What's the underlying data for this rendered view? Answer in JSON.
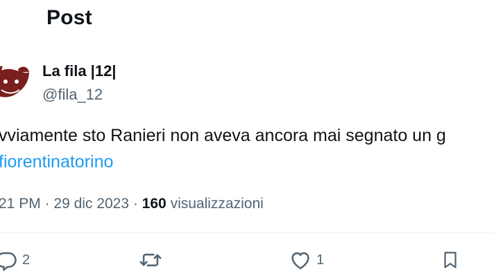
{
  "header": {
    "title": "Post"
  },
  "author": {
    "display_name": "La fila |12|",
    "handle": "@fila_12",
    "avatar_icon": "team-crest-avatar"
  },
  "tweet": {
    "text": "vviamente sto Ranieri non aveva ancora mai segnato un g",
    "hashtag": "fiorentinatorino"
  },
  "meta": {
    "time": "21 PM",
    "separator": "·",
    "date": "29 dic 2023",
    "views_count": "160",
    "views_label": "visualizzazioni"
  },
  "actions": {
    "reply_count": "2",
    "like_count": "1",
    "icons": [
      "reply-icon",
      "retweet-icon",
      "like-icon",
      "bookmark-icon"
    ]
  },
  "colors": {
    "text": "#0f1419",
    "secondary": "#536471",
    "link": "#1d9bf0",
    "avatar_maroon": "#7a1f1f"
  }
}
